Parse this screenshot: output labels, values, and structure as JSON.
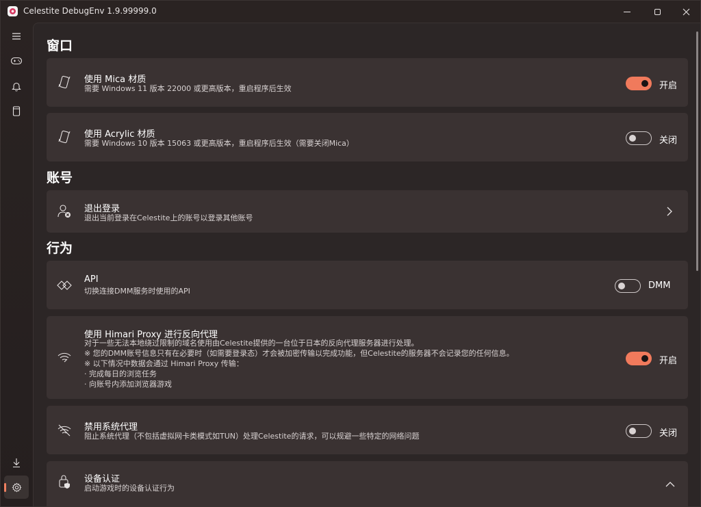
{
  "window": {
    "title": "Celestite DebugEnv 1.9.99999.0"
  },
  "sidebar": {
    "items": [
      {
        "icon": "menu-icon"
      },
      {
        "icon": "gamepad-icon"
      },
      {
        "icon": "bell-icon"
      },
      {
        "icon": "tablet-icon"
      },
      {
        "icon": "download-icon"
      },
      {
        "icon": "gear-icon",
        "active": true
      }
    ]
  },
  "sections": {
    "window": "窗口",
    "account": "账号",
    "behavior": "行为"
  },
  "settings": {
    "mica": {
      "title": "使用 Mica 材质",
      "desc": "需要 Windows 11 版本 22000 或更高版本，重启程序后生效",
      "state": "开启"
    },
    "acrylic": {
      "title": "使用 Acrylic 材质",
      "desc": "需要 Windows 10 版本 15063 或更高版本，重启程序后生效（需要关闭Mica）",
      "state": "关闭"
    },
    "logout": {
      "title": "退出登录",
      "desc": "退出当前登录在Celestite上的账号以登录其他账号"
    },
    "api": {
      "title": "API",
      "desc": "切换连接DMM服务时使用的API",
      "state": "DMM"
    },
    "proxy": {
      "title": "使用 Himari Proxy 进行反向代理",
      "desc_lines": [
        "对于一些无法本地绕过限制的域名使用由Celestite提供的一台位于日本的反向代理服务器进行处理。",
        "※ 您的DMM账号信息只有在必要时（如需要登录态）才会被加密传输以完成功能，但Celestite的服务器不会记录您的任何信息。",
        "※ 以下情况中数据会通过 Himari Proxy 传输：",
        "· 完成每日的浏览任务",
        "· 向账号内添加浏览器游戏"
      ],
      "state": "开启"
    },
    "sysproxy": {
      "title": "禁用系统代理",
      "desc": "阻止系统代理（不包括虚拟网卡类模式如TUN）处理Celestite的请求，可以规避一些特定的网络问题",
      "state": "关闭"
    },
    "device": {
      "title": "设备认证",
      "desc": "启动游戏时的设备认证行为"
    }
  },
  "colors": {
    "accent": "#f07a5c",
    "card": "#3a3232",
    "background": "#2c2626"
  }
}
